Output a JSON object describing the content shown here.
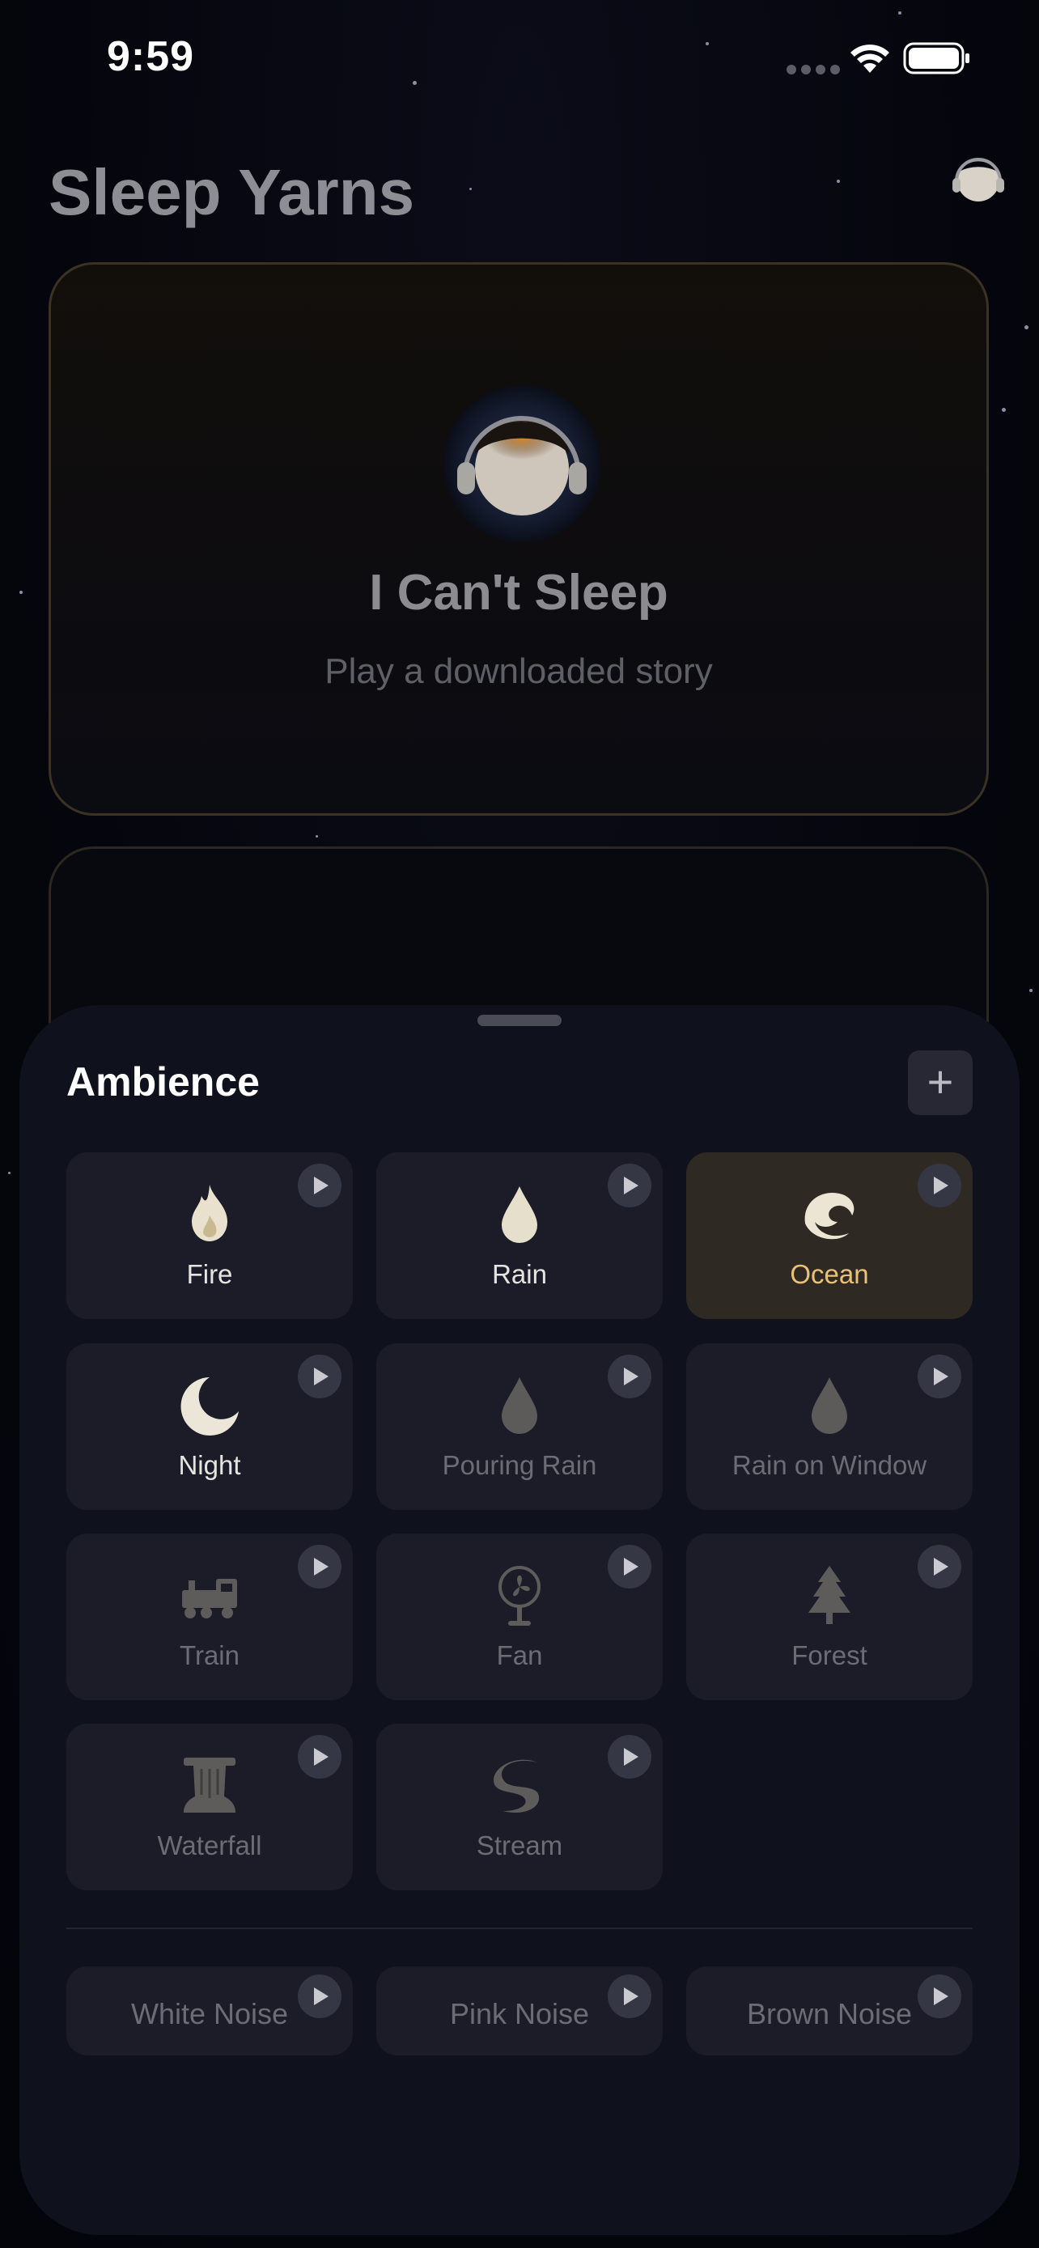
{
  "status_bar": {
    "time": "9:59"
  },
  "header": {
    "title": "Sleep Yarns"
  },
  "hero": {
    "title": "I Can't Sleep",
    "subtitle": "Play a downloaded story"
  },
  "ambience": {
    "title": "Ambience",
    "add_label": "+",
    "sounds": [
      {
        "label": "Fire",
        "icon": "fire-icon",
        "state": "on"
      },
      {
        "label": "Rain",
        "icon": "raindrop-icon",
        "state": "on"
      },
      {
        "label": "Ocean",
        "icon": "wave-icon",
        "state": "active"
      },
      {
        "label": "Night",
        "icon": "crescent-moon-icon",
        "state": "on"
      },
      {
        "label": "Pouring Rain",
        "icon": "raindrop-icon",
        "state": "off"
      },
      {
        "label": "Rain on Window",
        "icon": "raindrop-icon",
        "state": "off"
      },
      {
        "label": "Train",
        "icon": "train-icon",
        "state": "off"
      },
      {
        "label": "Fan",
        "icon": "fan-icon",
        "state": "off"
      },
      {
        "label": "Forest",
        "icon": "tree-icon",
        "state": "off"
      },
      {
        "label": "Waterfall",
        "icon": "waterfall-icon",
        "state": "off"
      },
      {
        "label": "Stream",
        "icon": "stream-icon",
        "state": "off"
      }
    ],
    "noises": [
      {
        "label": "White Noise"
      },
      {
        "label": "Pink Noise"
      },
      {
        "label": "Brown Noise"
      }
    ]
  },
  "colors": {
    "background": "#05060d",
    "sheet": "#0f111c",
    "tile": "#1b1c28",
    "active_tile": "#2e2923",
    "active_label": "#e9c27a",
    "card_border": "#3a3222"
  }
}
